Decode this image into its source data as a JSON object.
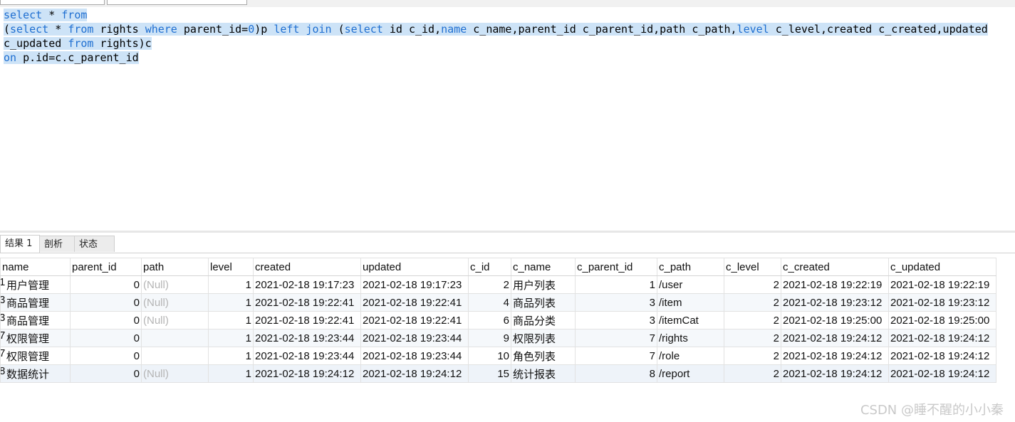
{
  "editor": {
    "line1": {
      "kw1": "select",
      "t1": " * ",
      "kw2": "from"
    },
    "line2": {
      "p1": "(",
      "kw1": "select",
      "t1": " * ",
      "kw2": "from",
      "t2": " rights ",
      "kw3": "where",
      "t3": " parent_id=",
      "num": "0",
      "t4": ")p ",
      "kw4": "left join",
      "t5": " (",
      "kw5": "select",
      "t6": " id c_id,",
      "kw6": "name",
      "t7": " c_name,parent_id c_parent_id,path c_path,",
      "kw7": "level",
      "t8": " c_level,created c_created,updated"
    },
    "line3": {
      "t1": "c_updated ",
      "kw1": "from",
      "t2": " rights)c"
    },
    "line4": {
      "kw1": "on",
      "t1": " p.id=c.c_parent_id"
    }
  },
  "tabs": [
    {
      "label": "结果 1"
    },
    {
      "label": "剖析"
    },
    {
      "label": "状态"
    }
  ],
  "columns": [
    "name",
    "parent_id",
    "path",
    "level",
    "created",
    "updated",
    "c_id",
    "c_name",
    "c_parent_id",
    "c_path",
    "c_level",
    "c_created",
    "c_updated"
  ],
  "rows": [
    {
      "mark": "1",
      "name": "用户管理",
      "parent_id": "0",
      "path": "(Null)",
      "level": "1",
      "created": "2021-02-18 19:17:23",
      "updated": "2021-02-18 19:17:23",
      "c_id": "2",
      "c_name": "用户列表",
      "c_parent_id": "1",
      "c_path": "/user",
      "c_level": "2",
      "c_created": "2021-02-18 19:22:19",
      "c_updated": "2021-02-18 19:22:19"
    },
    {
      "mark": "3",
      "name": "商品管理",
      "parent_id": "0",
      "path": "(Null)",
      "level": "1",
      "created": "2021-02-18 19:22:41",
      "updated": "2021-02-18 19:22:41",
      "c_id": "4",
      "c_name": "商品列表",
      "c_parent_id": "3",
      "c_path": "/item",
      "c_level": "2",
      "c_created": "2021-02-18 19:23:12",
      "c_updated": "2021-02-18 19:23:12"
    },
    {
      "mark": "3",
      "name": "商品管理",
      "parent_id": "0",
      "path": "(Null)",
      "level": "1",
      "created": "2021-02-18 19:22:41",
      "updated": "2021-02-18 19:22:41",
      "c_id": "6",
      "c_name": "商品分类",
      "c_parent_id": "3",
      "c_path": "/itemCat",
      "c_level": "2",
      "c_created": "2021-02-18 19:25:00",
      "c_updated": "2021-02-18 19:25:00"
    },
    {
      "mark": "7",
      "name": "权限管理",
      "parent_id": "0",
      "path": "",
      "level": "1",
      "created": "2021-02-18 19:23:44",
      "updated": "2021-02-18 19:23:44",
      "c_id": "9",
      "c_name": "权限列表",
      "c_parent_id": "7",
      "c_path": "/rights",
      "c_level": "2",
      "c_created": "2021-02-18 19:24:12",
      "c_updated": "2021-02-18 19:24:12"
    },
    {
      "mark": "7",
      "name": "权限管理",
      "parent_id": "0",
      "path": "",
      "level": "1",
      "created": "2021-02-18 19:23:44",
      "updated": "2021-02-18 19:23:44",
      "c_id": "10",
      "c_name": "角色列表",
      "c_parent_id": "7",
      "c_path": "/role",
      "c_level": "2",
      "c_created": "2021-02-18 19:24:12",
      "c_updated": "2021-02-18 19:24:12"
    },
    {
      "mark": "8",
      "name": "数据统计",
      "parent_id": "0",
      "path": "(Null)",
      "level": "1",
      "created": "2021-02-18 19:24:12",
      "updated": "2021-02-18 19:24:12",
      "c_id": "15",
      "c_name": "统计报表",
      "c_parent_id": "8",
      "c_path": "/report",
      "c_level": "2",
      "c_created": "2021-02-18 19:24:12",
      "c_updated": "2021-02-18 19:24:12"
    }
  ],
  "watermark": "CSDN @睡不醒的小小秦"
}
